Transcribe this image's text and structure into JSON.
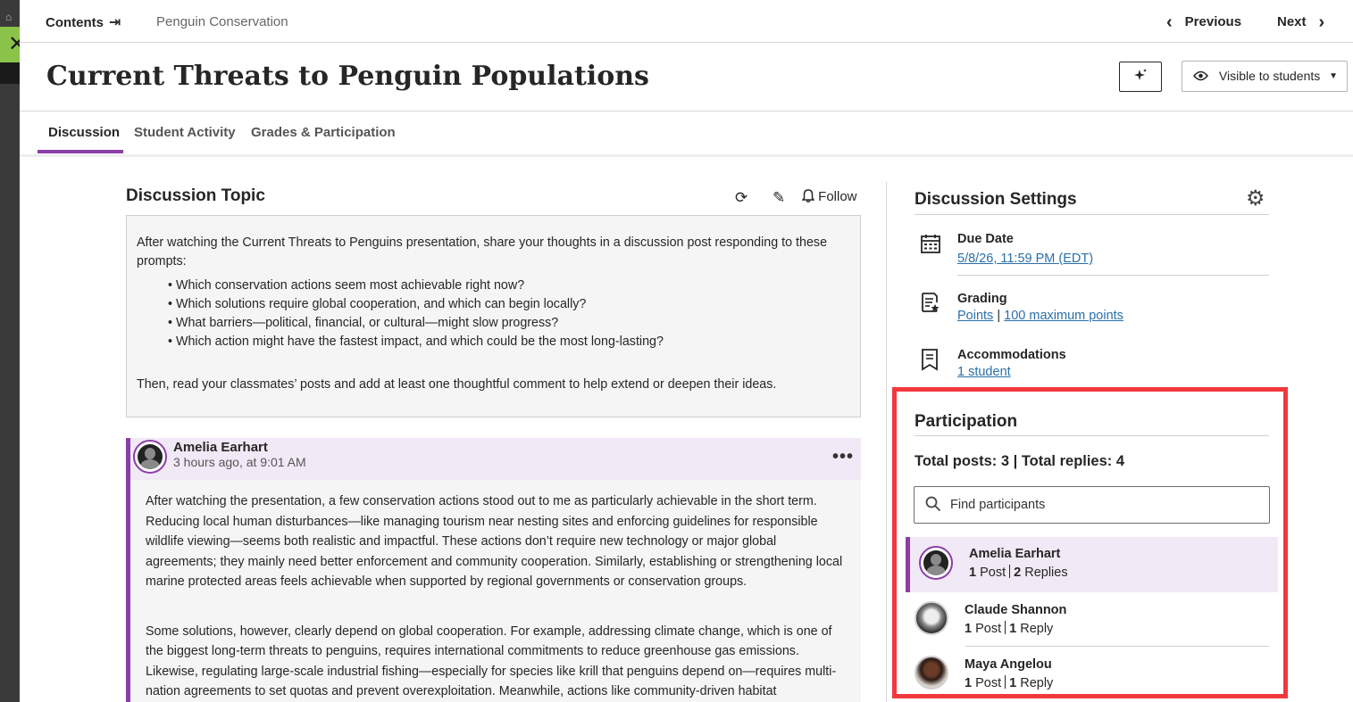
{
  "nav": {
    "contents_label": "Contents",
    "breadcrumb": "Penguin Conservation",
    "previous_label": "Previous",
    "next_label": "Next"
  },
  "page": {
    "title": "Current Threats to Penguin Populations",
    "visibility_label": "Visible to students"
  },
  "tabs": [
    {
      "label": "Discussion",
      "active": true
    },
    {
      "label": "Student Activity",
      "active": false
    },
    {
      "label": "Grades & Participation",
      "active": false
    }
  ],
  "discussion": {
    "heading": "Discussion Topic",
    "follow_label": "Follow",
    "prompt_intro": "After watching the Current Threats to Penguins presentation, share your thoughts in a discussion post responding to these prompts:",
    "prompt_bullets": [
      "Which conservation actions seem most achievable right now?",
      "Which solutions require global cooperation, and which can begin locally?",
      "What barriers—political, financial, or cultural—might slow progress?",
      "Which action might have the fastest impact, and which could be the most long-lasting?"
    ],
    "prompt_outro": "Then, read your classmates’ posts and add at least one thoughtful comment to help extend or deepen their ideas."
  },
  "post": {
    "author": "Amelia Earhart",
    "time": "3 hours ago, at 9:01 AM",
    "paragraphs": [
      "After watching the presentation, a few conservation actions stood out to me as particularly achievable in the short term. Reducing local human disturbances—like managing tourism near nesting sites and enforcing guidelines for responsible wildlife viewing—seems both realistic and impactful. These actions don’t require new technology or major global agreements; they mainly need better enforcement and community cooperation. Similarly, establishing or strengthening local marine protected areas feels achievable when supported by regional governments or conservation groups.",
      "Some solutions, however, clearly depend on global cooperation. For example, addressing climate change, which is one of the biggest long-term threats to penguins, requires international commitments to reduce greenhouse gas emissions. Likewise, regulating large-scale industrial fishing—especially for species like krill that penguins depend on—requires multi-nation agreements to set quotas and prevent overexploitation. Meanwhile, actions like community-driven habitat"
    ]
  },
  "settings": {
    "heading": "Discussion Settings",
    "due_date_label": "Due Date",
    "due_date_value": "5/8/26, 11:59 PM (EDT)",
    "grading_label": "Grading",
    "grading_type": "Points",
    "grading_separator": "|",
    "grading_max": "100 maximum points",
    "accommodations_label": "Accommodations",
    "accommodations_value": "1 student"
  },
  "participation": {
    "heading": "Participation",
    "totals": "Total posts: 3 | Total replies: 4",
    "search_placeholder": "Find participants",
    "participants": [
      {
        "name": "Amelia Earhart",
        "posts": "1",
        "posts_label": "Post",
        "replies": "2",
        "replies_label": "Replies"
      },
      {
        "name": "Claude Shannon",
        "posts": "1",
        "posts_label": "Post",
        "replies": "1",
        "replies_label": "Reply"
      },
      {
        "name": "Maya Angelou",
        "posts": "1",
        "posts_label": "Post",
        "replies": "1",
        "replies_label": "Reply"
      }
    ]
  },
  "colors": {
    "accent": "#8b3ea8",
    "highlight_border": "#f2383d",
    "link": "#2a6fa8",
    "close_button": "#8bc34a"
  }
}
